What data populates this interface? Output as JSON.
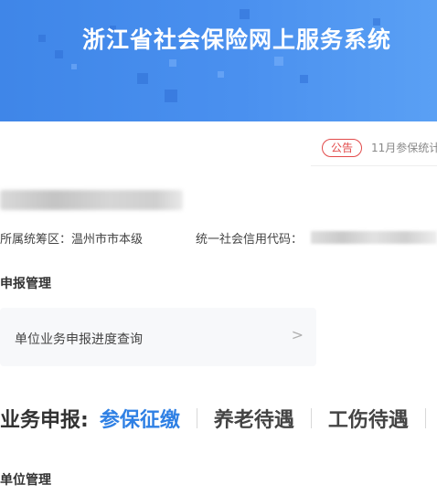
{
  "banner": {
    "title": "浙江省社会保险网上服务系统"
  },
  "notice": {
    "badge": "公告",
    "text": "11月参保统计"
  },
  "unit": {
    "district_label": "所属统筹区：温州市市本级",
    "credit_code_label": "统一社会信用代码："
  },
  "sections": {
    "declare_manage": "申报管理",
    "unit_manage": "单位管理"
  },
  "card": {
    "label": "单位业务申报进度查询",
    "arrow": ">"
  },
  "business": {
    "prefix": "业务申报:",
    "tabs": [
      {
        "label": "参保征缴",
        "active": true
      },
      {
        "label": "养老待遇",
        "active": false
      },
      {
        "label": "工伤待遇",
        "active": false
      }
    ]
  },
  "colors": {
    "accent": "#2f80e4",
    "notice": "#e24a4a",
    "banner": "#4a90ef"
  }
}
